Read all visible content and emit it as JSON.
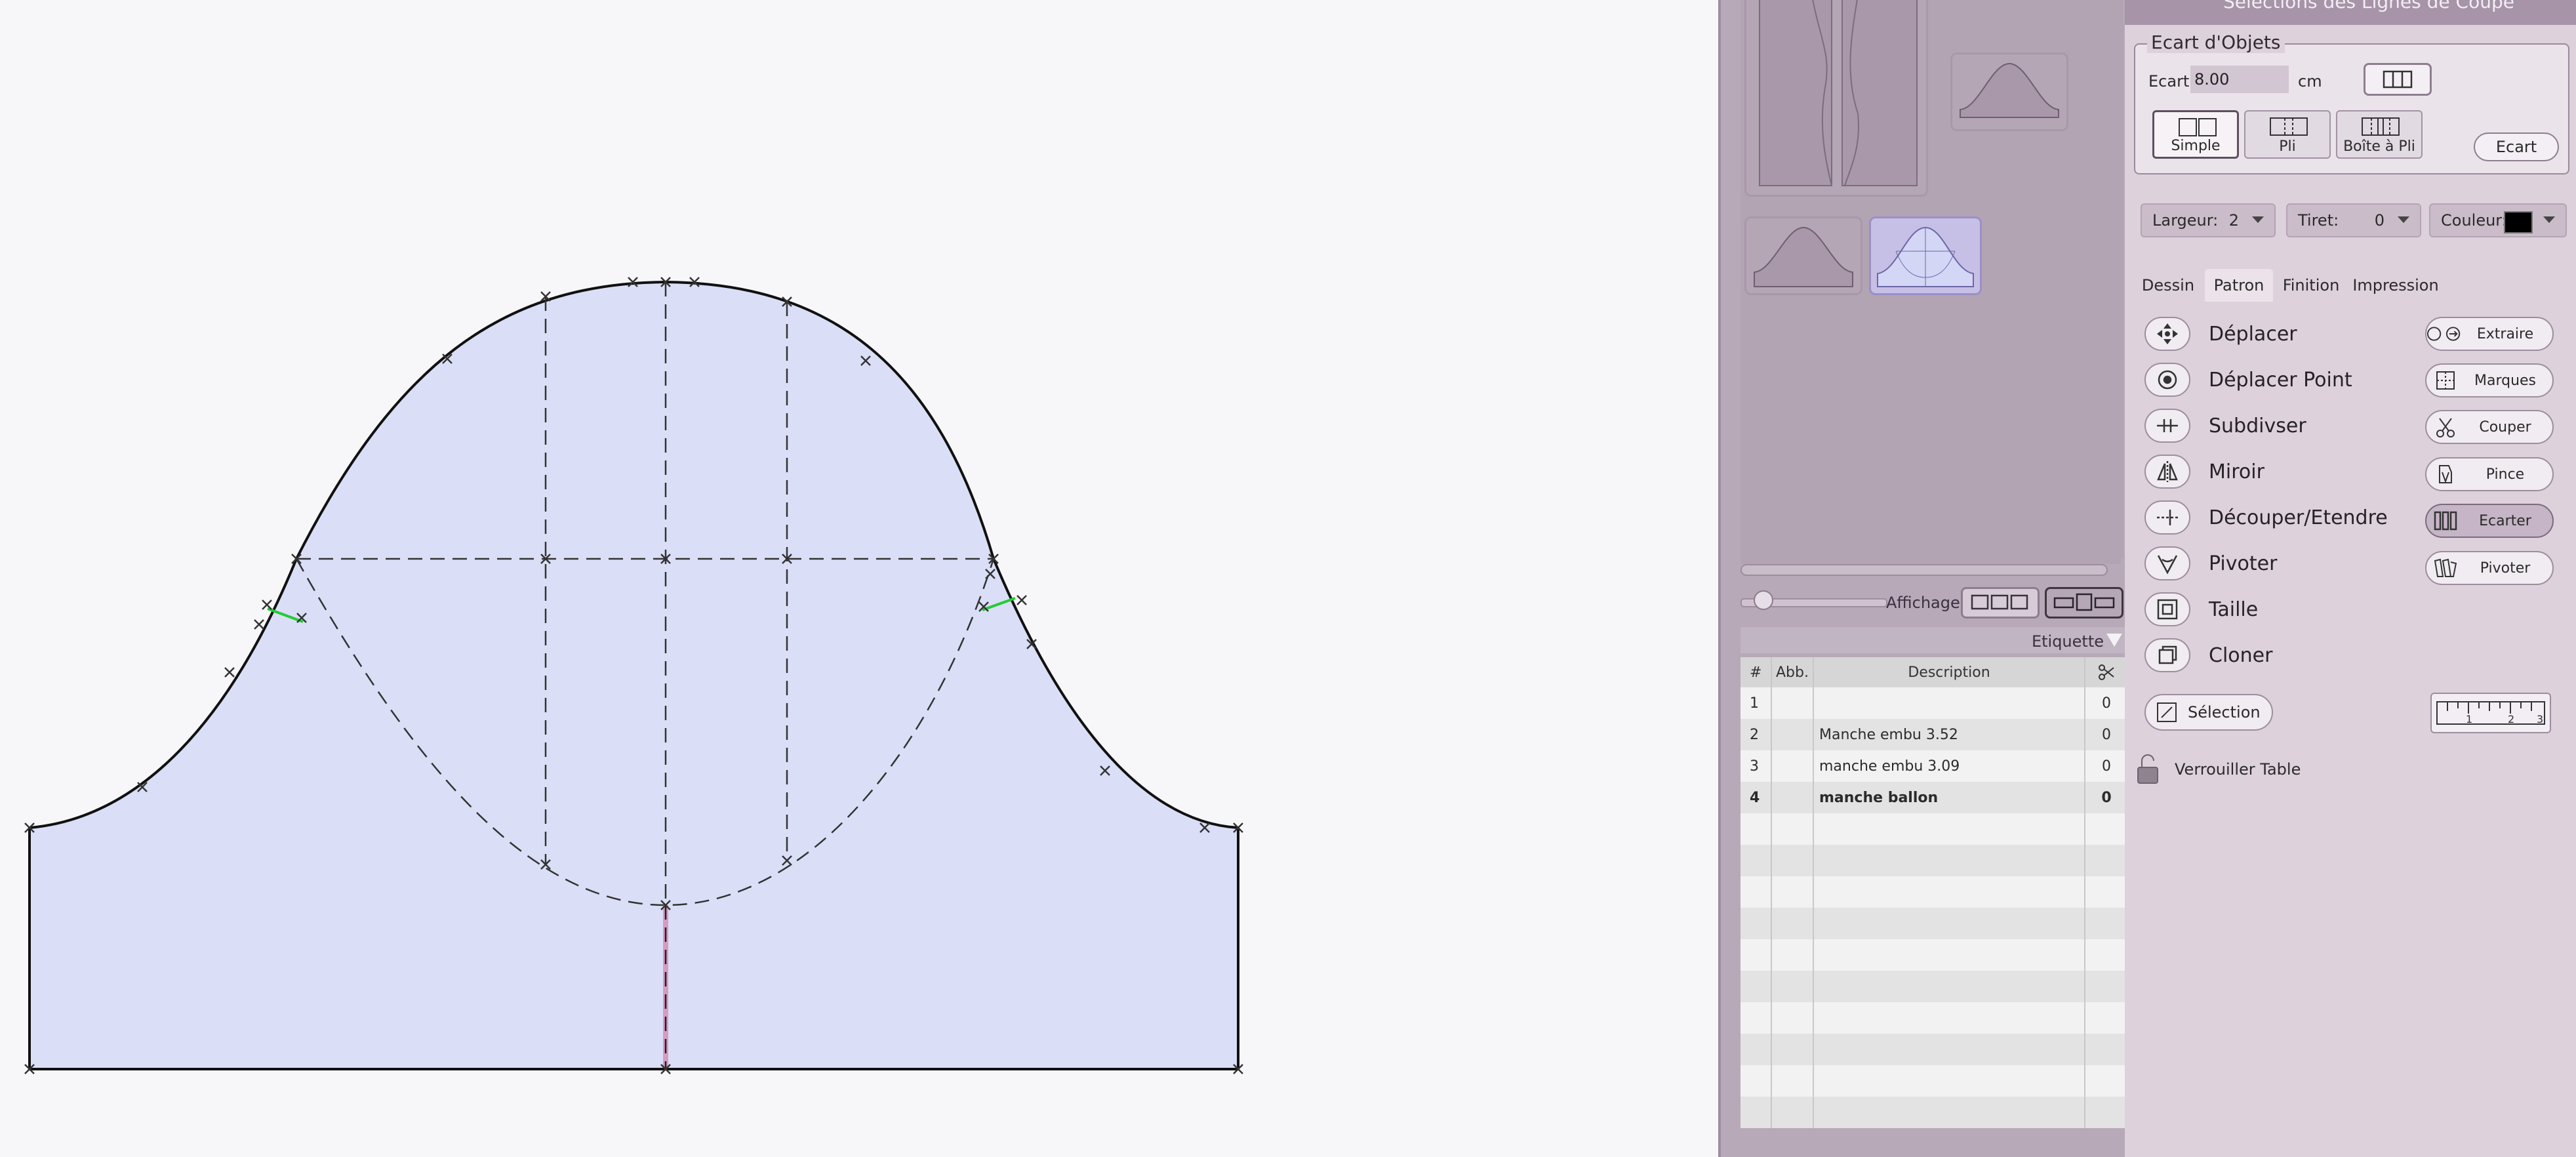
{
  "window": {
    "top_title": "Sélections des Lignes de Coupe"
  },
  "thumbnails": [
    "pattern-set-thumbnail",
    "sleeve-thumbnail-1",
    "sleeve-thumbnail-2",
    "sleeve-thumbnail-selected"
  ],
  "display": {
    "label": "Affichage"
  },
  "etiquette": {
    "header": "Etiquette",
    "columns": {
      "num": "#",
      "abb": "Abb.",
      "desc": "Description"
    },
    "rows": [
      {
        "num": "1",
        "abb": "",
        "desc": "",
        "val": "0"
      },
      {
        "num": "2",
        "abb": "",
        "desc": "Manche embu 3.52",
        "val": "0"
      },
      {
        "num": "3",
        "abb": "",
        "desc": "manche embu  3.09",
        "val": "0"
      },
      {
        "num": "4",
        "abb": "",
        "desc": "manche ballon",
        "val": "0",
        "bold": true
      }
    ]
  },
  "ecart": {
    "legend": "Ecart d'Objets",
    "label": "Ecart",
    "value": "8.00",
    "unit": "cm",
    "modes": [
      "Simple",
      "Pli",
      "Boîte à Pli"
    ],
    "active_mode": "Simple",
    "apply_label": "Ecart"
  },
  "line": {
    "width_label": "Largeur:",
    "width_value": "2",
    "dash_label": "Tiret:",
    "dash_value": "0",
    "color_label": "Couleur:",
    "color_value": "#000000"
  },
  "tabs": {
    "dessin": "Dessin",
    "patron": "Patron",
    "finition": "Finition",
    "impression": "Impression",
    "active": "Patron"
  },
  "tools": {
    "deplacer": "Déplacer",
    "deplacer_point": "Déplacer Point",
    "subdiviser": "Subdivser",
    "miroir": "Miroir",
    "decouper": "Découper/Etendre",
    "pivoter": "Pivoter",
    "taille": "Taille",
    "cloner": "Cloner"
  },
  "actions": {
    "extraire": "Extraire",
    "marques": "Marques",
    "couper": "Couper",
    "pince": "Pince",
    "ecarter": "Ecarter",
    "pivoter": "Pivoter",
    "active": "Ecarter"
  },
  "selection": {
    "label": "Sélection"
  },
  "lock": {
    "label": "Verrouiller Table"
  },
  "colors": {
    "pattern_fill": "#dadff7",
    "panel_bg": "#ddd1dc",
    "mid_panel": "#b7a9b8",
    "seam_marker": "#22cc33",
    "grain_line": "#d66fa0"
  }
}
